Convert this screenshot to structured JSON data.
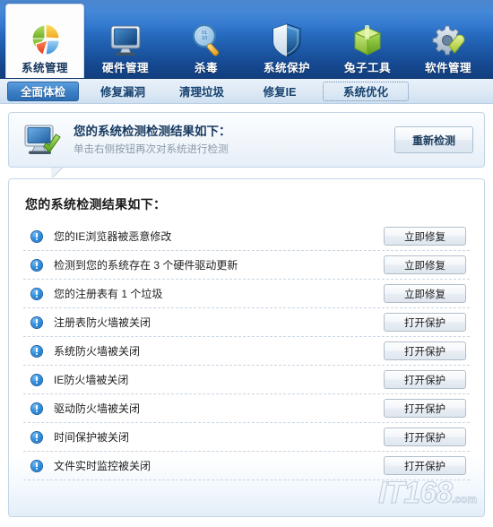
{
  "app": {
    "title": "系统管理",
    "watermark": "IT168",
    "watermark_suffix": ".com"
  },
  "topnav": {
    "items": [
      {
        "label": "系统管理",
        "icon": "pie-chart-icon",
        "active": true
      },
      {
        "label": "硬件管理",
        "icon": "monitor-icon",
        "active": false
      },
      {
        "label": "杀毒",
        "icon": "magnifier-icon",
        "active": false
      },
      {
        "label": "系统保护",
        "icon": "shield-icon",
        "active": false
      },
      {
        "label": "兔子工具",
        "icon": "green-box-icon",
        "active": false
      },
      {
        "label": "软件管理",
        "icon": "gear-wrench-icon",
        "active": false
      }
    ]
  },
  "tabs": {
    "items": [
      {
        "label": "全面体检",
        "state": "selected"
      },
      {
        "label": "修复漏洞",
        "state": "normal"
      },
      {
        "label": "清理垃圾",
        "state": "normal"
      },
      {
        "label": "修复IE",
        "state": "normal"
      },
      {
        "label": "系统优化",
        "state": "focused"
      }
    ]
  },
  "summary": {
    "icon": "monitor-check-icon",
    "title": "您的系统检测检测结果如下：",
    "subtitle": "单击右侧按钮再次对系统进行检测",
    "rescan_label": "重新检测"
  },
  "results": {
    "title": "您的系统检测结果如下：",
    "rows": [
      {
        "icon": "alert-info-icon",
        "label": "您的IE浏览器被恶意修改",
        "action": "立即修复"
      },
      {
        "icon": "alert-info-icon",
        "label": "检测到您的系统存在 3 个硬件驱动更新",
        "action": "立即修复"
      },
      {
        "icon": "alert-info-icon",
        "label": "您的注册表有 1 个垃圾",
        "action": "立即修复"
      },
      {
        "icon": "alert-info-icon",
        "label": "注册表防火墙被关闭",
        "action": "打开保护"
      },
      {
        "icon": "alert-info-icon",
        "label": "系统防火墙被关闭",
        "action": "打开保护"
      },
      {
        "icon": "alert-info-icon",
        "label": "IE防火墙被关闭",
        "action": "打开保护"
      },
      {
        "icon": "alert-info-icon",
        "label": "驱动防火墙被关闭",
        "action": "打开保护"
      },
      {
        "icon": "alert-info-icon",
        "label": "时间保护被关闭",
        "action": "打开保护"
      },
      {
        "icon": "alert-info-icon",
        "label": "文件实时监控被关闭",
        "action": "打开保护"
      }
    ]
  },
  "colors": {
    "nav_blue_top": "#2f7ad3",
    "nav_blue_bottom": "#123f80",
    "tab_selected_blue": "#3c7fc6",
    "panel_border": "#c3d6e8",
    "alert_blue": "#2f8fe0",
    "title_text": "#17395e"
  }
}
